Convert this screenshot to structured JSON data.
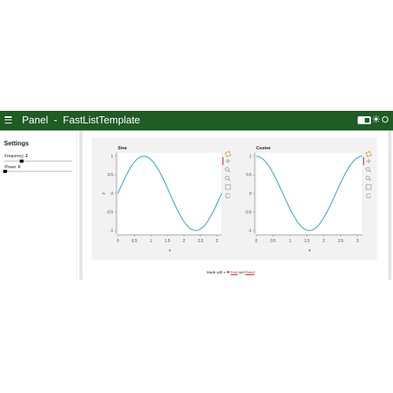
{
  "header": {
    "title": "Panel  -  FastListTemplate",
    "bg_color": "#1f5d25",
    "menu_icon": "hamburger-icon",
    "theme_icons": [
      "theme-toggle-icon",
      "sun-icon",
      "circle-icon"
    ]
  },
  "sidebar": {
    "title": "Settings",
    "sliders": [
      {
        "label": "Frequency",
        "value": "2",
        "fraction": 0.23
      },
      {
        "label": "Phase",
        "value": "0",
        "fraction": 0.0
      }
    ]
  },
  "chart_data": [
    {
      "type": "line",
      "title": "Sine",
      "xlabel": "x",
      "ylabel": "y",
      "xlim": [
        0,
        3.1416
      ],
      "ylim": [
        -1.1,
        1.1
      ],
      "xticks": [
        "0",
        "0.5",
        "1",
        "1.5",
        "2",
        "2.5",
        "3"
      ],
      "yticks": [
        "1",
        "0.5",
        "0",
        "-0.5",
        "-1"
      ],
      "function": "sin(2x)",
      "x": [
        0,
        0.25,
        0.5,
        0.785,
        1.0,
        1.25,
        1.5,
        1.75,
        2.0,
        2.356,
        2.5,
        2.75,
        3.0,
        3.1416
      ],
      "y": [
        0,
        0.479,
        0.841,
        1.0,
        0.909,
        0.598,
        0.141,
        -0.351,
        -0.757,
        -1.0,
        -0.959,
        -0.706,
        -0.279,
        0
      ],
      "color": "#1f9bd7"
    },
    {
      "type": "line",
      "title": "Cosine",
      "xlabel": "x",
      "ylabel": "",
      "xlim": [
        0,
        3.1416
      ],
      "ylim": [
        -1.1,
        1.1
      ],
      "xticks": [
        "0",
        "0.5",
        "1",
        "1.5",
        "2",
        "2.5",
        "3"
      ],
      "yticks": [
        "1",
        "0.5",
        "0",
        "-0.5",
        "-1"
      ],
      "function": "cos(2x)",
      "x": [
        0,
        0.25,
        0.5,
        0.785,
        1.0,
        1.25,
        1.5708,
        1.75,
        2.0,
        2.356,
        2.5,
        2.75,
        3.0,
        3.1416
      ],
      "y": [
        1.0,
        0.878,
        0.54,
        0,
        -0.416,
        -0.801,
        -1.0,
        -0.936,
        -0.654,
        0,
        0.284,
        0.709,
        0.96,
        1.0
      ],
      "color": "#1f9bd7"
    }
  ],
  "toolbar_icons": [
    "bokeh-logo-icon",
    "pan-icon",
    "box-zoom-icon",
    "wheel-zoom-icon",
    "save-icon",
    "reset-icon"
  ],
  "footer": {
    "prefix": "Made with",
    "sep": "and",
    "link1": "Fast",
    "link2": "Panel"
  }
}
